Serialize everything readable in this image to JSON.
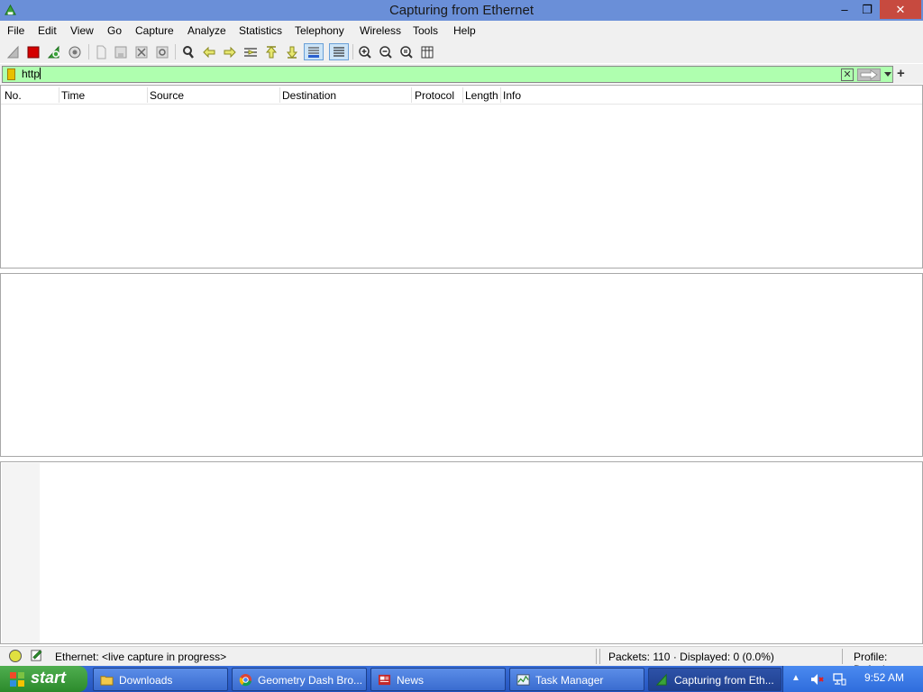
{
  "window": {
    "title": "Capturing from Ethernet",
    "minimize_glyph": "–",
    "maximize_glyph": "❐",
    "close_glyph": "✕"
  },
  "menu": [
    "File",
    "Edit",
    "View",
    "Go",
    "Capture",
    "Analyze",
    "Statistics",
    "Telephony",
    "Wireless",
    "Tools",
    "Help"
  ],
  "toolbar": {
    "icons": [
      "shark-fin-icon",
      "stop-icon",
      "restart-icon",
      "capture-options-icon",
      "open-file-icon",
      "save-file-icon",
      "close-file-icon",
      "reload-icon",
      "find-packet-icon",
      "go-back-icon",
      "go-forward-icon",
      "go-to-packet-icon",
      "go-first-icon",
      "go-last-icon",
      "autoscroll-icon",
      "colorize-icon",
      "zoom-in-icon",
      "zoom-out-icon",
      "normal-size-icon",
      "resize-columns-icon"
    ]
  },
  "filter": {
    "value": "http",
    "plus_glyph": "+",
    "clear_glyph": "✕",
    "bg_color": "#afffaf"
  },
  "packet_list": {
    "columns": [
      "No.",
      "Time",
      "Source",
      "Destination",
      "Protocol",
      "Length",
      "Info"
    ]
  },
  "status": {
    "interface": "Ethernet: <live capture in progress>",
    "packets": "Packets: 110 · Displayed: 0 (0.0%)",
    "profile": "Profile: Default"
  },
  "taskbar": {
    "start_label": "start",
    "tasks": [
      {
        "label": "Downloads",
        "icon": "folder-icon"
      },
      {
        "label": "Geometry Dash Bro...",
        "icon": "chrome-icon"
      },
      {
        "label": "News",
        "icon": "news-icon"
      },
      {
        "label": "Task Manager",
        "icon": "task-manager-icon"
      },
      {
        "label": "Capturing from Eth...",
        "icon": "wireshark-icon"
      }
    ],
    "clock": "9:52 AM"
  }
}
